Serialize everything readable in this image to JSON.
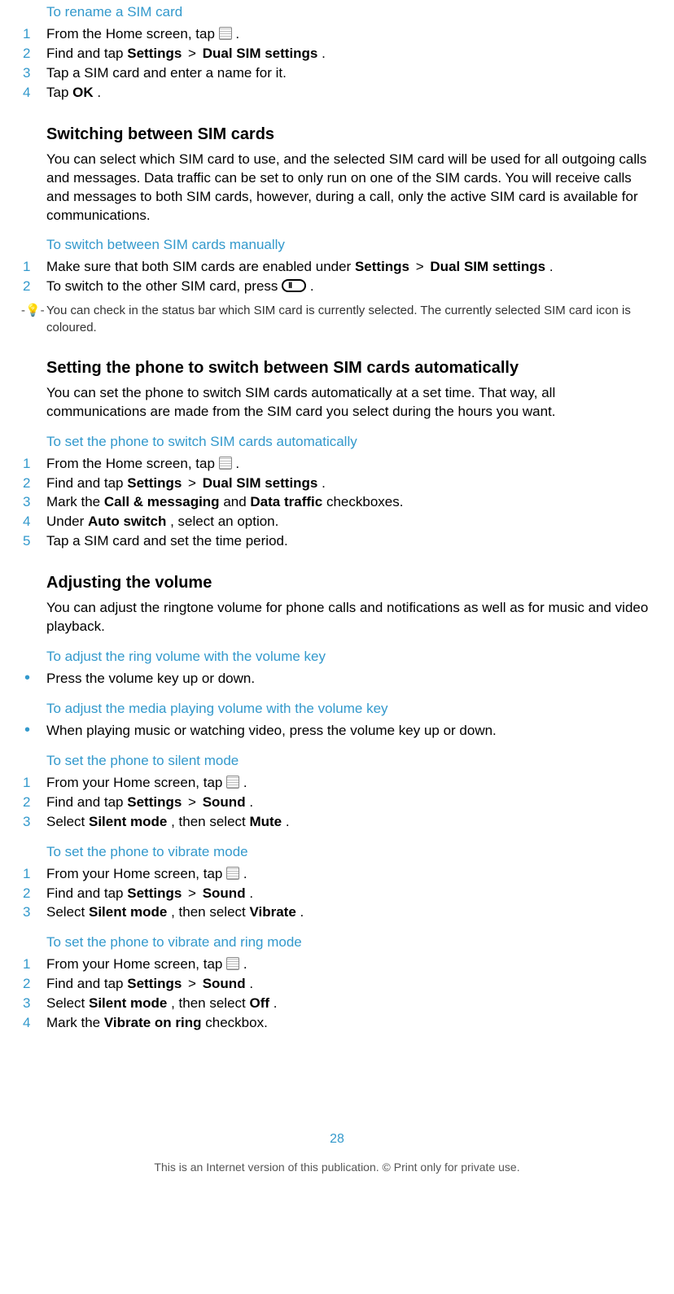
{
  "section1": {
    "title": "To rename a SIM card",
    "steps": [
      {
        "n": "1",
        "prefix": "From the Home screen, tap ",
        "suffix": " ."
      },
      {
        "n": "2",
        "t1": "Find and tap ",
        "b1": "Settings",
        "sep": " > ",
        "b2": "Dual SIM settings",
        "t2": "."
      },
      {
        "n": "3",
        "text": "Tap a SIM card and enter a name for it."
      },
      {
        "n": "4",
        "t1": "Tap ",
        "b1": "OK",
        "t2": "."
      }
    ]
  },
  "section2": {
    "head": "Switching between SIM cards",
    "para": "You can select which SIM card to use, and the selected SIM card will be used for all outgoing calls and messages. Data traffic can be set to only run on one of the SIM cards. You will receive calls and messages to both SIM cards, however, during a call, only the active SIM card is available for communications.",
    "sub": "To switch between SIM cards manually",
    "steps": {
      "s1": {
        "n": "1",
        "t1": "Make sure that both SIM cards are enabled under ",
        "b1": "Settings",
        "sep": " > ",
        "b2": "Dual SIM settings",
        "t2": "."
      },
      "s2": {
        "n": "2",
        "prefix": "To switch to the other SIM card, press ",
        "suffix": "."
      }
    },
    "tip": "You can check in the status bar which SIM card is currently selected. The currently selected SIM card icon is coloured."
  },
  "section3": {
    "head": "Setting the phone to switch between SIM cards automatically",
    "para": "You can set the phone to switch SIM cards automatically at a set time. That way, all communications are made from the SIM card you select during the hours you want.",
    "sub": "To set the phone to switch SIM cards automatically",
    "steps": {
      "s1": {
        "n": "1",
        "prefix": "From the Home screen, tap ",
        "suffix": " ."
      },
      "s2": {
        "n": "2",
        "t1": "Find and tap ",
        "b1": "Settings",
        "sep": " > ",
        "b2": "Dual SIM settings",
        "t2": "."
      },
      "s3": {
        "n": "3",
        "t1": "Mark the ",
        "b1": "Call & messaging",
        "mid": " and ",
        "b2": "Data traffic",
        "t2": " checkboxes."
      },
      "s4": {
        "n": "4",
        "t1": "Under ",
        "b1": "Auto switch",
        "t2": ", select an option."
      },
      "s5": {
        "n": "5",
        "text": "Tap a SIM card and set the time period."
      }
    }
  },
  "section4": {
    "head": "Adjusting the volume",
    "para": "You can adjust the ringtone volume for phone calls and notifications as well as for music and video playback.",
    "sub1": "To adjust the ring volume with the volume key",
    "b1": "Press the volume key up or down.",
    "sub2": "To adjust the media playing volume with the volume key",
    "b2": "When playing music or watching video, press the volume key up or down."
  },
  "section5": {
    "sub": "To set the phone to silent mode",
    "steps": {
      "s1": {
        "n": "1",
        "prefix": "From your Home screen, tap ",
        "suffix": "."
      },
      "s2": {
        "n": "2",
        "t1": "Find and tap ",
        "b1": "Settings",
        "sep": " > ",
        "b2": "Sound",
        "t2": "."
      },
      "s3": {
        "n": "3",
        "t1": "Select ",
        "b1": "Silent mode",
        "mid": ", then select ",
        "b2": "Mute",
        "t2": "."
      }
    }
  },
  "section6": {
    "sub": "To set the phone to vibrate mode",
    "steps": {
      "s1": {
        "n": "1",
        "prefix": "From your Home screen, tap ",
        "suffix": "."
      },
      "s2": {
        "n": "2",
        "t1": "Find and tap ",
        "b1": "Settings",
        "sep": " > ",
        "b2": "Sound",
        "t2": "."
      },
      "s3": {
        "n": "3",
        "t1": "Select ",
        "b1": "Silent mode",
        "mid": ", then select ",
        "b2": "Vibrate",
        "t2": "."
      }
    }
  },
  "section7": {
    "sub": "To set the phone to vibrate and ring mode",
    "steps": {
      "s1": {
        "n": "1",
        "prefix": "From your Home screen, tap ",
        "suffix": "."
      },
      "s2": {
        "n": "2",
        "t1": "Find and tap ",
        "b1": "Settings",
        "sep": " > ",
        "b2": "Sound",
        "t2": "."
      },
      "s3": {
        "n": "3",
        "t1": "Select ",
        "b1": "Silent mode",
        "mid": ", then select ",
        "b2": "Off",
        "t2": "."
      },
      "s4": {
        "n": "4",
        "t1": "Mark the ",
        "b1": "Vibrate on ring",
        "t2": " checkbox."
      }
    }
  },
  "page_num": "28",
  "footer": "This is an Internet version of this publication. © Print only for private use."
}
